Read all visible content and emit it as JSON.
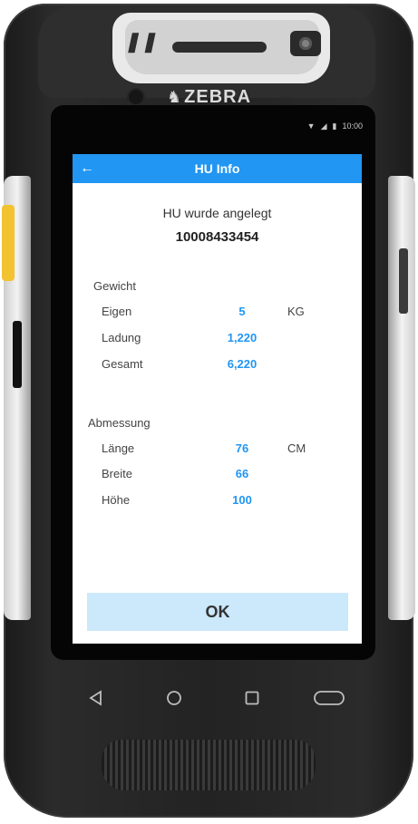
{
  "device": {
    "brand": "ZEBRA",
    "status_time": "10:00"
  },
  "appbar": {
    "title": "HU Info"
  },
  "info": {
    "message": "HU wurde angelegt",
    "hu_number": "10008433454"
  },
  "weight": {
    "section_label": "Gewicht",
    "unit": "KG",
    "rows": [
      {
        "label": "Eigen",
        "value": "5"
      },
      {
        "label": "Ladung",
        "value": "1,220"
      },
      {
        "label": "Gesamt",
        "value": "6,220"
      }
    ]
  },
  "dimensions": {
    "section_label": "Abmessung",
    "unit": "CM",
    "rows": [
      {
        "label": "Länge",
        "value": "76"
      },
      {
        "label": "Breite",
        "value": "66"
      },
      {
        "label": "Höhe",
        "value": "100"
      }
    ]
  },
  "actions": {
    "ok_label": "OK"
  },
  "colors": {
    "accent": "#2196f3",
    "button_bg": "#cce8fb"
  }
}
